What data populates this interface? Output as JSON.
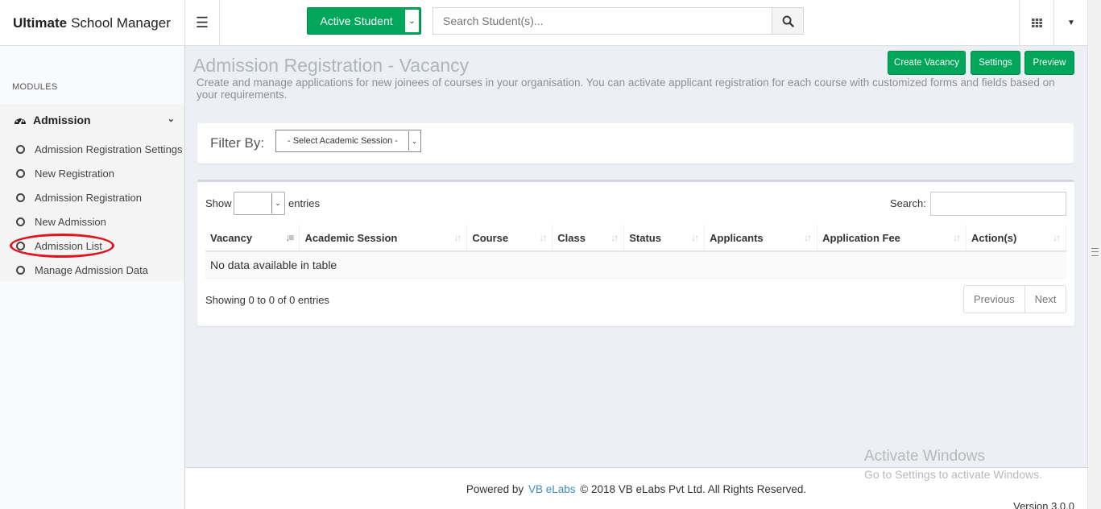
{
  "header": {
    "brand_bold": "Ultimate",
    "brand_rest": "School Manager",
    "menu_icon": "hamburger-icon",
    "student_filter": "Active Student",
    "search_placeholder": "Search Student(s)...",
    "search_icon": "search-icon",
    "apps_icon": "grid-icon",
    "user_menu_icon": "caret-down-icon"
  },
  "sidebar": {
    "section_header": "MODULES",
    "menu": {
      "icon": "dashboard-icon",
      "label": "Admission",
      "items": [
        {
          "label": "Admission Registration Settings"
        },
        {
          "label": "New Registration"
        },
        {
          "label": "Admission Registration"
        },
        {
          "label": "New Admission"
        },
        {
          "label": "Admission List",
          "highlighted": true
        },
        {
          "label": "Manage Admission Data"
        }
      ]
    }
  },
  "page": {
    "title": "Admission Registration - Vacancy",
    "description": "Create and manage applications for new joinees of courses in your organisation. You can activate applicant registration for each course with customized forms and fields based on your requirements.",
    "buttons": {
      "create_vacancy": "Create Vacancy",
      "settings": "Settings",
      "preview": "Preview"
    }
  },
  "filter": {
    "label": "Filter By:",
    "session_select": "- Select Academic Session -"
  },
  "table": {
    "show_label": "Show",
    "entries_value": "",
    "entries_label": "entries",
    "search_label": "Search:",
    "search_value": "",
    "columns": [
      "Vacancy",
      "Academic Session",
      "Course",
      "Class",
      "Status",
      "Applicants",
      "Application Fee",
      "Action(s)"
    ],
    "empty_message": "No data available in table",
    "info": "Showing 0 to 0 of 0 entries",
    "pagination": {
      "previous": "Previous",
      "next": "Next"
    }
  },
  "footer": {
    "powered_by": "Powered by",
    "company_link": "VB eLabs",
    "copyright": "© 2018 VB eLabs Pvt Ltd. All Rights Reserved.",
    "version": "Version 3.0.0"
  },
  "watermark": {
    "line1": "Activate Windows",
    "line2": "Go to Settings to activate Windows."
  },
  "colors": {
    "accent_green": "#00a65a",
    "link_blue": "#3c8dbc",
    "highlight_red": "#e0141f"
  }
}
